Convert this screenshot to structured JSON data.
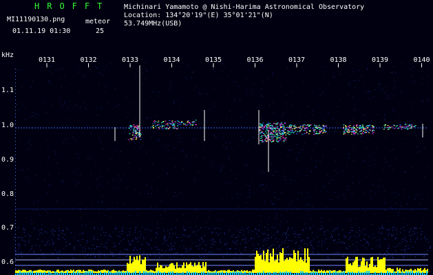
{
  "header": {
    "title": "HROFFT",
    "filename": "MI11190130.png",
    "meteor_label": "meteor",
    "datetime": "01.11.19 01:30",
    "meteor_count": "25"
  },
  "observatory": {
    "line1": "Michinari Yamamoto @ Nishi-Harima Astronomical Observatory",
    "line2": "Location: 134°20'19\"(E) 35°01'21\"(N)",
    "line3": "53.749MHz(USB)"
  },
  "axes": {
    "unit": "kHz",
    "time_labels": [
      "0131",
      "0132",
      "0133",
      "0134",
      "0135",
      "0136",
      "0137",
      "0138",
      "0139",
      "0140"
    ],
    "freq_labels": [
      "1.1",
      "1.0",
      "0.9",
      "0.8",
      "0.7",
      "0.6"
    ]
  },
  "colors": {
    "background": "#000010",
    "label_green": "#33ff33",
    "text_white": "#ffffff",
    "signal_high": "#ff33cc",
    "signal_mid": "#33ffcc",
    "signal_low": "#3366ff",
    "power_bar": "#ffff00",
    "power_base": "#00ccff"
  }
}
